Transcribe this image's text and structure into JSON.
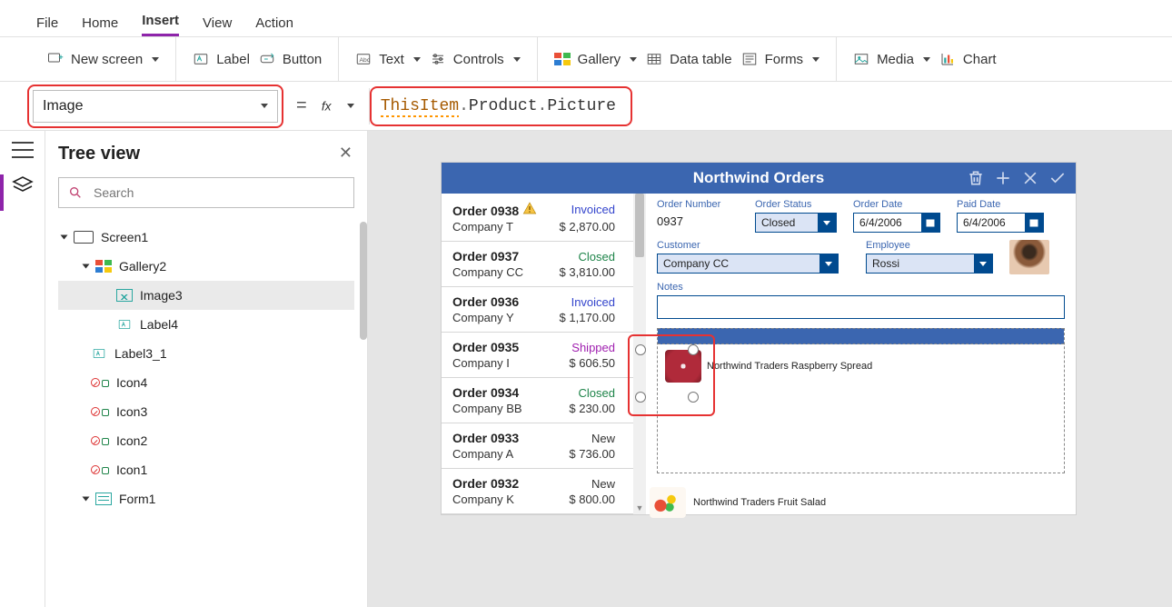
{
  "menubar": {
    "items": [
      "File",
      "Home",
      "Insert",
      "View",
      "Action"
    ],
    "activeIndex": 2
  },
  "ribbon": {
    "newscreen": "New screen",
    "label": "Label",
    "button": "Button",
    "text": "Text",
    "controls": "Controls",
    "gallery": "Gallery",
    "datatable": "Data table",
    "forms": "Forms",
    "media": "Media",
    "chart": "Chart"
  },
  "formula": {
    "property": "Image",
    "part1": "ThisItem",
    "part2": "Product",
    "part3": "Picture"
  },
  "tree": {
    "title": "Tree view",
    "searchPlaceholder": "Search",
    "nodes": {
      "screen1": "Screen1",
      "gallery2": "Gallery2",
      "image3": "Image3",
      "label4": "Label4",
      "label3_1": "Label3_1",
      "icon4": "Icon4",
      "icon3": "Icon3",
      "icon2": "Icon2",
      "icon1": "Icon1",
      "form1": "Form1"
    }
  },
  "app": {
    "title": "Northwind Orders",
    "orders": [
      {
        "id": "Order 0938",
        "company": "Company T",
        "status": "Invoiced",
        "statusColor": "invoiced",
        "amount": "$ 2,870.00",
        "warn": true
      },
      {
        "id": "Order 0937",
        "company": "Company CC",
        "status": "Closed",
        "statusColor": "closed",
        "amount": "$ 3,810.00",
        "warn": false
      },
      {
        "id": "Order 0936",
        "company": "Company Y",
        "status": "Invoiced",
        "statusColor": "invoiced",
        "amount": "$ 1,170.00",
        "warn": false
      },
      {
        "id": "Order 0935",
        "company": "Company I",
        "status": "Shipped",
        "statusColor": "shipped",
        "amount": "$ 606.50",
        "warn": false
      },
      {
        "id": "Order 0934",
        "company": "Company BB",
        "status": "Closed",
        "statusColor": "closed",
        "amount": "$ 230.00",
        "warn": false
      },
      {
        "id": "Order 0933",
        "company": "Company A",
        "status": "New",
        "statusColor": "new",
        "amount": "$ 736.00",
        "warn": false
      },
      {
        "id": "Order 0932",
        "company": "Company K",
        "status": "New",
        "statusColor": "new",
        "amount": "$ 800.00",
        "warn": false
      }
    ],
    "detail": {
      "orderNumberLabel": "Order Number",
      "orderNumber": "0937",
      "orderStatusLabel": "Order Status",
      "orderStatus": "Closed",
      "orderDateLabel": "Order Date",
      "orderDate": "6/4/2006",
      "paidDateLabel": "Paid Date",
      "paidDate": "6/4/2006",
      "customerLabel": "Customer",
      "customer": "Company CC",
      "employeeLabel": "Employee",
      "employee": "Rossi",
      "notesLabel": "Notes"
    },
    "galleryItems": [
      {
        "name": "Northwind Traders Raspberry Spread",
        "thumbClass": "raspberry"
      },
      {
        "name": "Northwind Traders Fruit Salad",
        "thumbClass": "fruit"
      }
    ]
  }
}
